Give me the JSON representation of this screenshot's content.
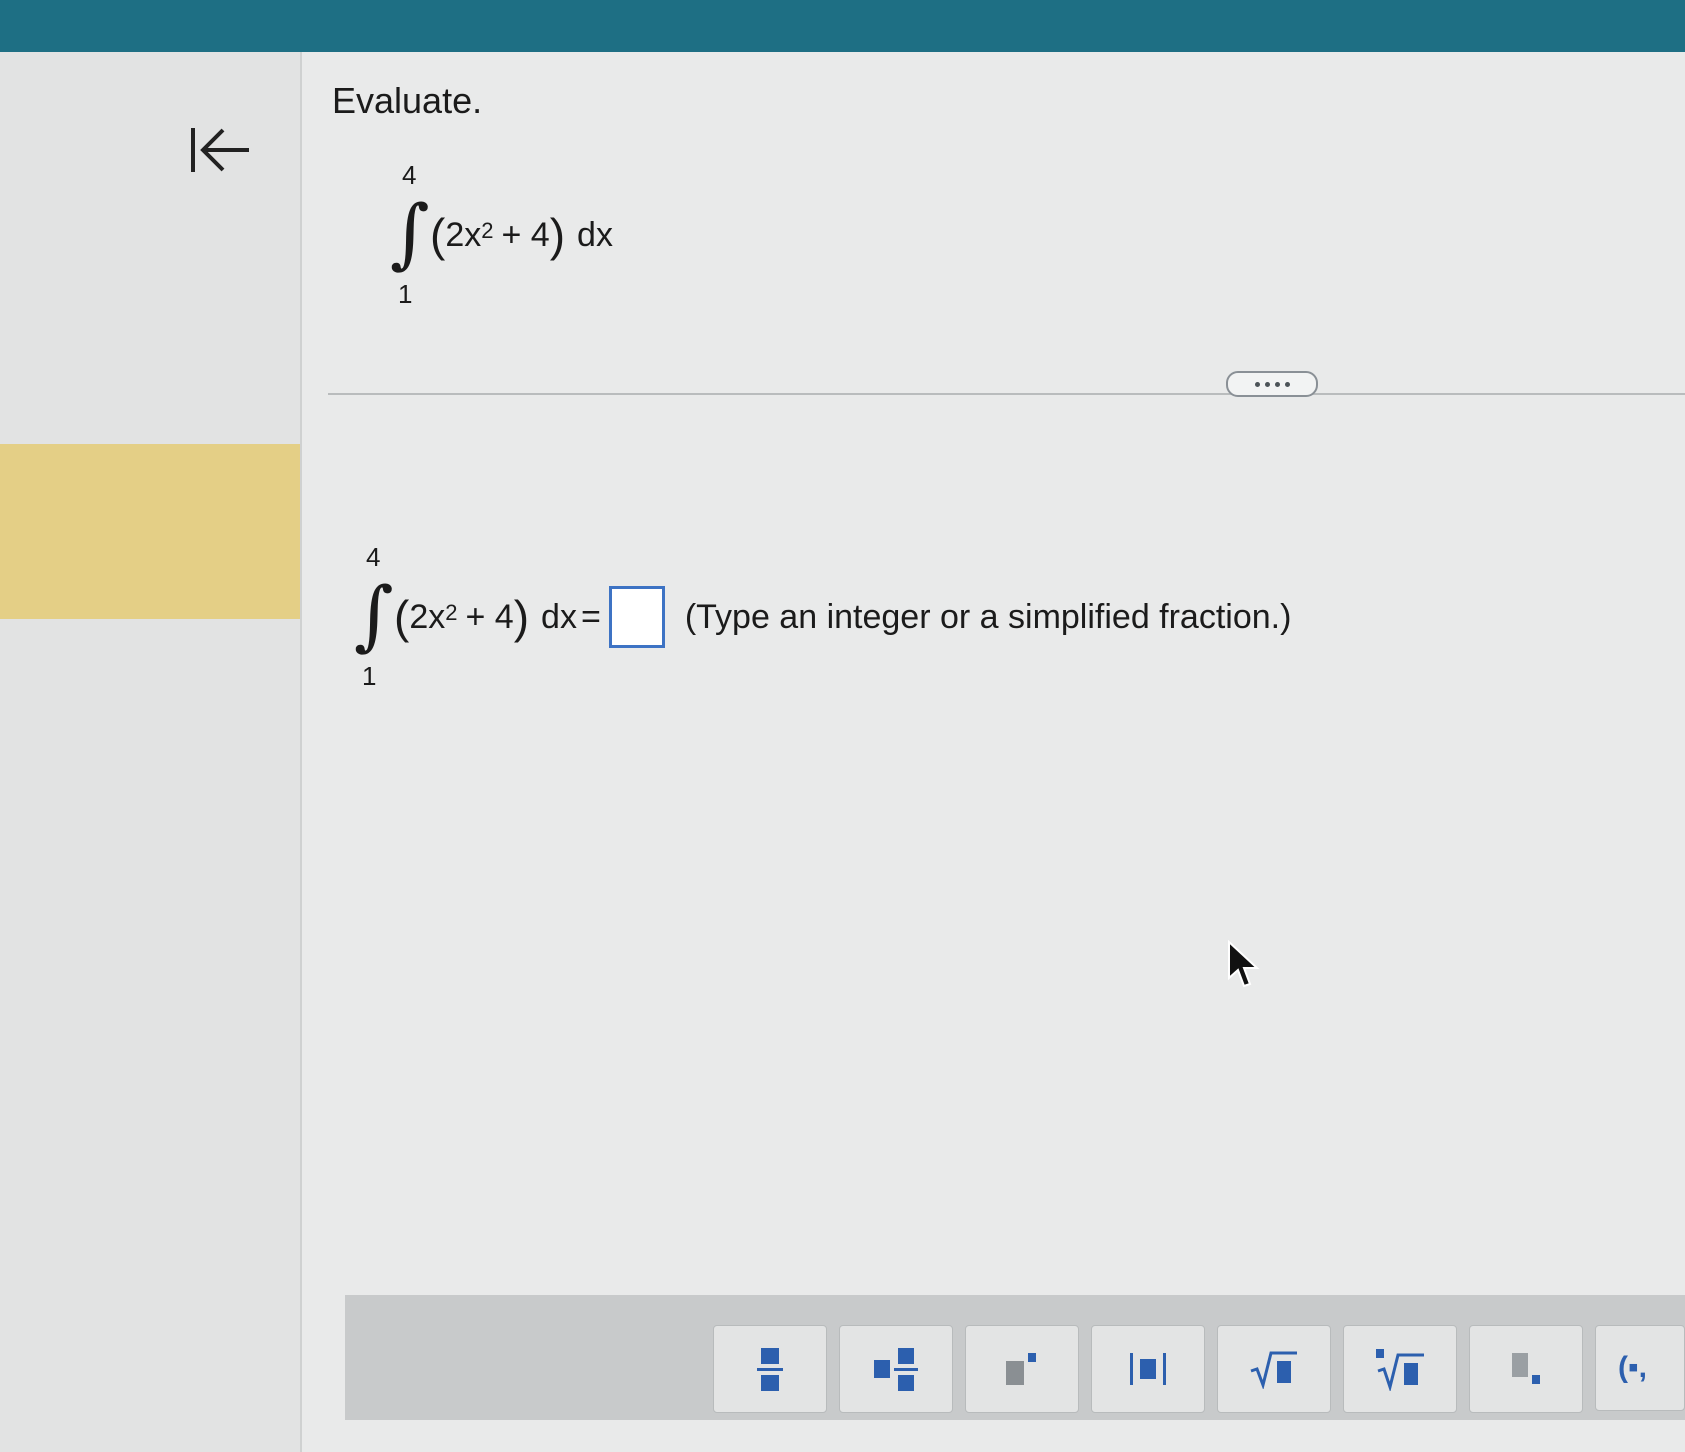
{
  "header": {
    "color": "#1e6f84"
  },
  "sidebar": {
    "collapse_icon": "collapse-left-icon",
    "highlight_color": "#e4cf86"
  },
  "question": {
    "prompt": "Evaluate.",
    "integral": {
      "upper": "4",
      "lower": "1",
      "open": "(",
      "close": ")",
      "coef": "2x",
      "exp": "2",
      "rest": "+ 4",
      "dx": "dx"
    }
  },
  "more_button": {
    "icon": "more-dots-icon"
  },
  "answer": {
    "integral": {
      "upper": "4",
      "lower": "1",
      "open": "(",
      "close": ")",
      "coef": "2x",
      "exp": "2",
      "rest": "+ 4",
      "dx": "dx",
      "equals": "="
    },
    "value": "",
    "hint": "(Type an integer or a simplified fraction.)",
    "box_color": "#3d73c4"
  },
  "math_toolbar": {
    "tools": [
      "fraction-icon",
      "mixed-number-icon",
      "exponent-icon",
      "absolute-value-icon",
      "square-root-icon",
      "nth-root-icon",
      "subscript-icon",
      "ordered-pair-icon"
    ],
    "ordered_pair_label": "(▪,"
  }
}
